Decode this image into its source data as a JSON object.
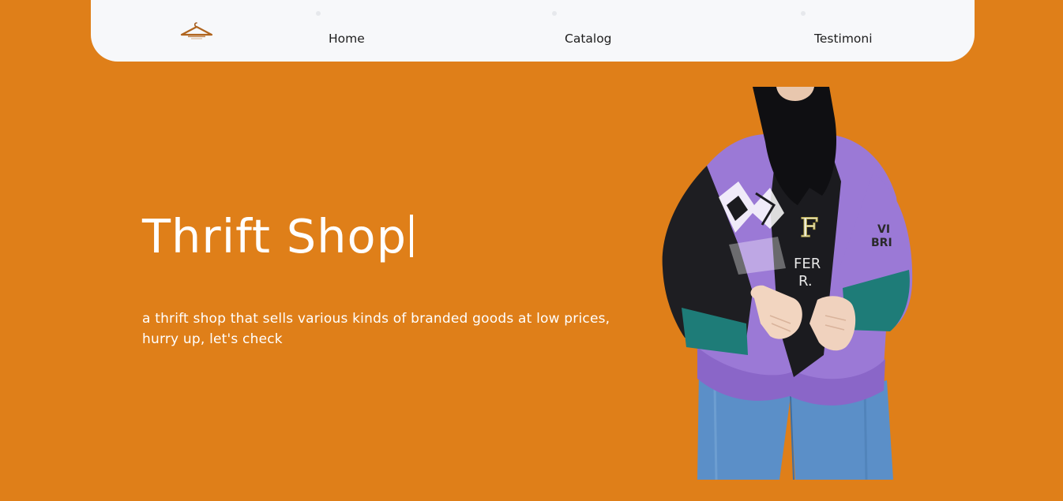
{
  "nav": {
    "items": [
      {
        "label": "Home"
      },
      {
        "label": "Catalog"
      },
      {
        "label": "Testimoni"
      }
    ]
  },
  "hero": {
    "title": "Thrift Shop",
    "subtitle": "a thrift shop that sells various kinds of branded goods at low prices, hurry up, let's check",
    "image_icon": "person-wearing-vintage-sweater-photo"
  },
  "colors": {
    "background": "#DF7F19",
    "navbar": "#F7F8FA",
    "text_light": "#FFFFFF",
    "text_dark": "#1D1D1D",
    "sweater_purple": "#9B79D6",
    "sweater_black": "#1B1B1F",
    "sweater_teal": "#1F7C7A",
    "jeans_blue": "#5A8DC6"
  }
}
